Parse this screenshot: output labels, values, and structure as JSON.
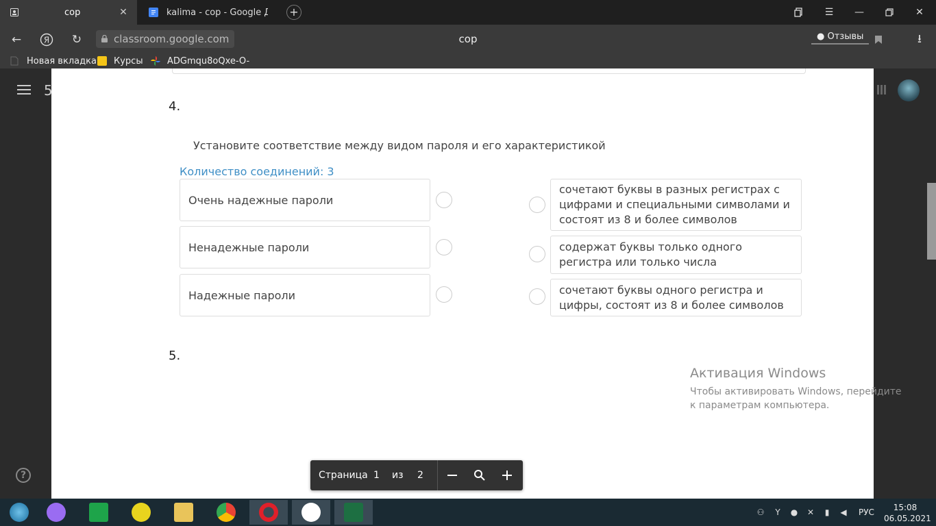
{
  "browser": {
    "tabs": [
      {
        "title": "сор",
        "active": true
      },
      {
        "title": "kalima - сор - Google Док",
        "active": false
      }
    ],
    "url": "classroom.google.com",
    "page_title": "сор",
    "reviews_label": "Отзывы",
    "bookmarks": [
      {
        "label": "Новая вкладка"
      },
      {
        "label": "Курсы"
      },
      {
        "label": "ADGmqu8oQxe-O-"
      }
    ]
  },
  "header": {
    "partial_title": "5"
  },
  "doc": {
    "question4_number": "4.",
    "question4_text": "Установите соответствие между видом пароля и его характеристикой",
    "connections_label": "Количество соединений: 3",
    "left_items": [
      {
        "label": "Очень надежные пароли"
      },
      {
        "label": "Ненадежные пароли"
      },
      {
        "label": "Надежные пароли"
      }
    ],
    "right_items": [
      {
        "label": "сочетают буквы в разных регистрах с цифрами и специальными символами и состоят из 8 и более символов"
      },
      {
        "label": "содержат буквы только одного регистра или только числа"
      },
      {
        "label": "сочетают буквы одного регистра и цифры, состоят из 8 и более символов"
      }
    ],
    "question5_number": "5."
  },
  "pager": {
    "page_label": "Страница",
    "current_page": "1",
    "of_label": "из",
    "total_pages": "2"
  },
  "watermark": {
    "title": "Активация Windows",
    "subtitle": "Чтобы активировать Windows, перейдите к параметрам компьютера."
  },
  "taskbar": {
    "language": "РУС",
    "time": "15:08",
    "date": "06.05.2021"
  },
  "colors": {
    "accent_link": "#3f8fc6",
    "doc_background": "#ffffff",
    "chrome_dark": "#3a3a3a"
  }
}
